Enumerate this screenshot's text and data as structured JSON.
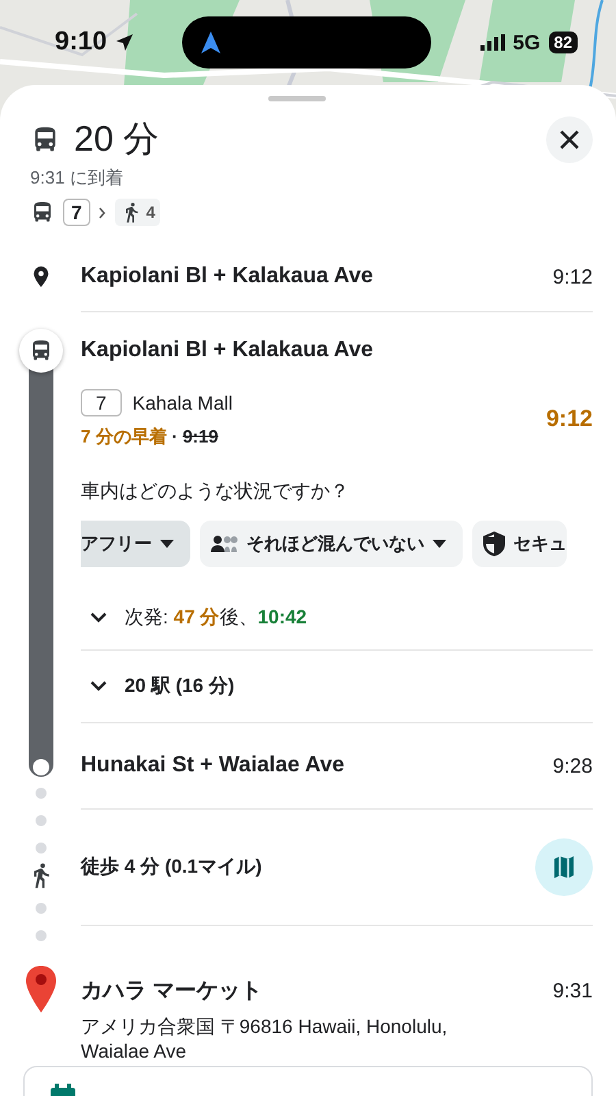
{
  "status_bar": {
    "time": "9:10",
    "network": "5G",
    "battery": "82"
  },
  "trip": {
    "duration": "20 分",
    "arrival": "9:31 に到着",
    "route": "7",
    "walk": "4"
  },
  "steps": [
    {
      "kind": "stop",
      "name": "Kapiolani Bl + Kalakaua Ave",
      "time": "9:12"
    },
    {
      "kind": "transit",
      "stop_name": "Kapiolani Bl + Kalakaua Ave",
      "route": "7",
      "headsign": "Kahala Mall",
      "time": "9:12",
      "early": "7 分の早着",
      "separator": "·",
      "scheduled": "9:19",
      "question": "車内はどのような状況ですか？",
      "chips": [
        {
          "kind": "plain",
          "label": "アフリー",
          "selected": true
        },
        {
          "kind": "crowd",
          "label": "それほど混んでいない",
          "selected": false
        },
        {
          "kind": "security",
          "label": "セキュ",
          "selected": false
        }
      ],
      "next": {
        "label": "次発:",
        "wait": "47 分",
        "suffix": "後、",
        "time": "10:42",
        "expanded": false
      },
      "stops": {
        "label": "20 駅 (16 分)",
        "expanded": false
      },
      "end_stop": {
        "name": "Hunakai St + Waialae Ave",
        "time": "9:28"
      }
    },
    {
      "kind": "walk",
      "label": "徒歩 4 分 (0.1マイル)"
    },
    {
      "kind": "destination",
      "name": "カハラ マーケット",
      "time": "9:31",
      "address": "アメリカ合衆国 〒96816 Hawaii, Honolulu, Waialae Ave"
    }
  ]
}
